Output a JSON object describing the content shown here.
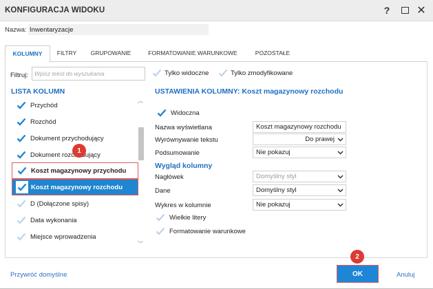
{
  "window": {
    "title": "KONFIGURACJA WIDOKU",
    "help": "?",
    "close": "✕"
  },
  "name": {
    "label": "Nazwa:",
    "value": "Inwentaryzacje"
  },
  "tabs": [
    {
      "label": "KOLUMNY",
      "active": true
    },
    {
      "label": "FILTRY"
    },
    {
      "label": "GRUPOWANIE"
    },
    {
      "label": "FORMATOWANIE WARUNKOWE"
    },
    {
      "label": "POZOSTAŁE"
    }
  ],
  "filter": {
    "label": "Filtruj:",
    "placeholder": "Wpisz tekst do wyszukania",
    "only_visible": "Tylko widoczne",
    "only_modified": "Tylko zmodyfikowane"
  },
  "column_list": {
    "title": "LISTA KOLUMN",
    "items": [
      {
        "label": "Przychód",
        "checked": true
      },
      {
        "label": "Rozchód",
        "checked": true
      },
      {
        "label": "Dokument przychodujący",
        "checked": true
      },
      {
        "label": "Dokument rozchodujący",
        "checked": true
      },
      {
        "label": "Koszt magazynowy przychodu",
        "checked": true
      },
      {
        "label": "Koszt magazynowy rozchodu",
        "checked": true,
        "selected": true
      },
      {
        "label": "D (Dołączone spisy)",
        "checked": false
      },
      {
        "label": "Data wykonania",
        "checked": false
      },
      {
        "label": "Miejsce wprowadzenia",
        "checked": false
      }
    ]
  },
  "settings": {
    "title": "USTAWIENIA KOLUMNY: Koszt magazynowy rozchodu",
    "visible_label": "Widoczna",
    "display_name_label": "Nazwa wyświetlana",
    "display_name_value": "Koszt magazynowy rozchodu",
    "alignment_label": "Wyrównywanie tekstu",
    "alignment_value": "Do prawej",
    "summary_label": "Podsumowanie",
    "summary_value": "Nie pokazuj"
  },
  "appearance": {
    "title": "Wygląd kolumny",
    "header_label": "Nagłówek",
    "header_value": "Domyślny styl",
    "data_label": "Dane",
    "data_value": "Domyślny styl",
    "chart_label": "Wykres w kolumnie",
    "chart_value": "Nie pokazuj",
    "uppercase_label": "Wielkie litery",
    "conditional_label": "Formatowanie warunkowe"
  },
  "badges": {
    "first": "1",
    "second": "2"
  },
  "footer": {
    "reset_label": "Przywróć domyślne",
    "ok_label": "OK",
    "cancel_label": "Anuluj"
  },
  "colors": {
    "accent": "#2070c0",
    "selected_row": "#1f86cf",
    "highlight_border": "#e05a5a",
    "badge": "#dc3b32",
    "check_on": "#1f86cf",
    "check_off": "#bcd3ea"
  }
}
